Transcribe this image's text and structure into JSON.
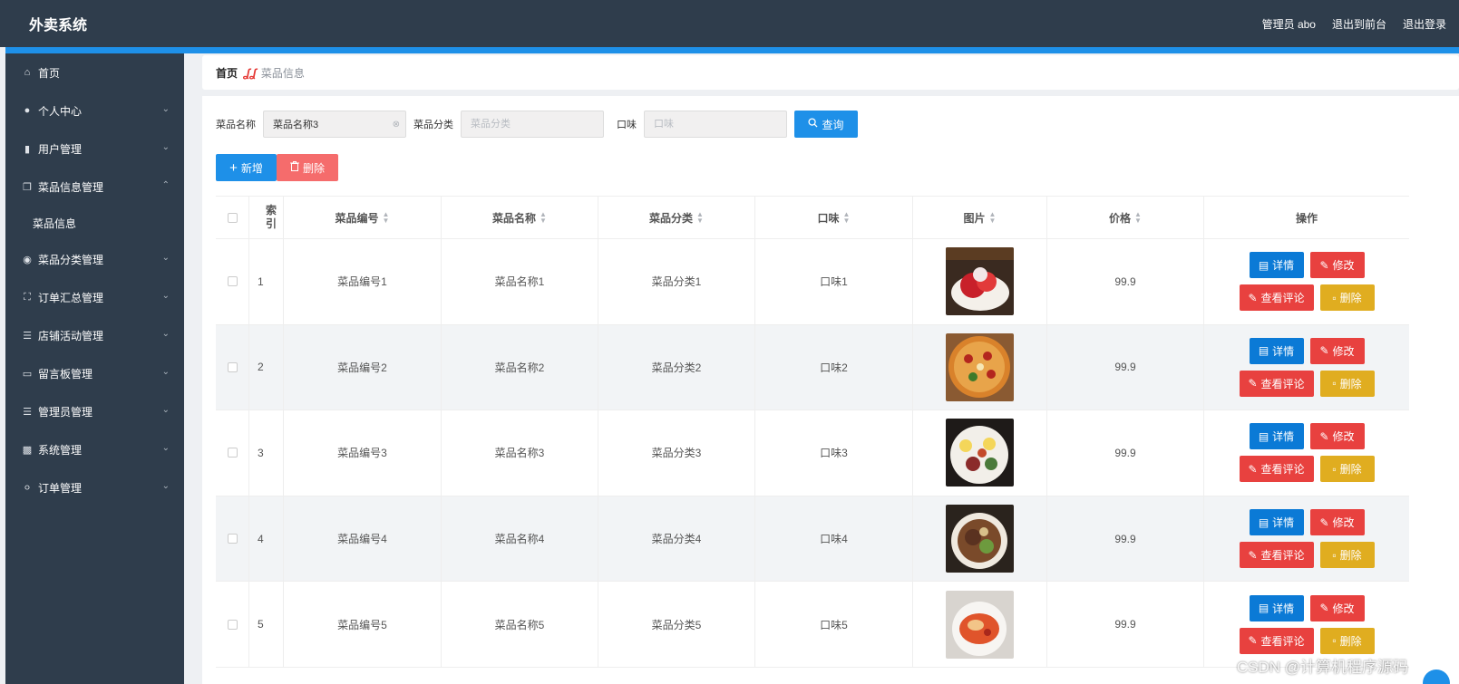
{
  "header": {
    "brand": "外卖系统",
    "admin": "管理员 abo",
    "to_front": "退出到前台",
    "logout": "退出登录"
  },
  "sidebar": {
    "items": [
      {
        "label": "首页",
        "icon": "home-icon",
        "expandable": false
      },
      {
        "label": "个人中心",
        "icon": "user-icon",
        "expandable": true
      },
      {
        "label": "用户管理",
        "icon": "user-manage-icon",
        "expandable": true
      },
      {
        "label": "菜品信息管理",
        "icon": "copy-icon",
        "expandable": true,
        "expanded": true
      },
      {
        "label": "菜品分类管理",
        "icon": "location-icon",
        "expandable": true
      },
      {
        "label": "订单汇总管理",
        "icon": "full-screen-icon",
        "expandable": true
      },
      {
        "label": "店铺活动管理",
        "icon": "list-icon",
        "expandable": true
      },
      {
        "label": "留言板管理",
        "icon": "monitor-icon",
        "expandable": true
      },
      {
        "label": "管理员管理",
        "icon": "menu-icon",
        "expandable": true
      },
      {
        "label": "系统管理",
        "icon": "clipboard-icon",
        "expandable": true
      },
      {
        "label": "订单管理",
        "icon": "microphone-icon",
        "expandable": true
      }
    ],
    "sub_item": "菜品信息"
  },
  "breadcrumb": {
    "home": "首页",
    "current": "菜品信息"
  },
  "search": {
    "name_label": "菜品名称",
    "name_value": "菜品名称3",
    "category_label": "菜品分类",
    "category_placeholder": "菜品分类",
    "taste_label": "口味",
    "taste_placeholder": "口味",
    "query": "查询"
  },
  "actions": {
    "add": "新增",
    "delete": "删除"
  },
  "table": {
    "headers": {
      "index": "索引",
      "code": "菜品编号",
      "name": "菜品名称",
      "category": "菜品分类",
      "taste": "口味",
      "image": "图片",
      "price": "价格",
      "ops": "操作"
    },
    "rows": [
      {
        "index": "1",
        "code": "菜品编号1",
        "name": "菜品名称1",
        "category": "菜品分类1",
        "taste": "口味1",
        "price": "99.9"
      },
      {
        "index": "2",
        "code": "菜品编号2",
        "name": "菜品名称2",
        "category": "菜品分类2",
        "taste": "口味2",
        "price": "99.9"
      },
      {
        "index": "3",
        "code": "菜品编号3",
        "name": "菜品名称3",
        "category": "菜品分类3",
        "taste": "口味3",
        "price": "99.9"
      },
      {
        "index": "4",
        "code": "菜品编号4",
        "name": "菜品名称4",
        "category": "菜品分类4",
        "taste": "口味4",
        "price": "99.9"
      },
      {
        "index": "5",
        "code": "菜品编号5",
        "name": "菜品名称5",
        "category": "菜品分类5",
        "taste": "口味5",
        "price": "99.9"
      }
    ],
    "row_ops": {
      "detail": "详情",
      "edit": "修改",
      "review": "查看评论",
      "remove": "删除"
    }
  },
  "watermark": "CSDN @计算机程序源码"
}
